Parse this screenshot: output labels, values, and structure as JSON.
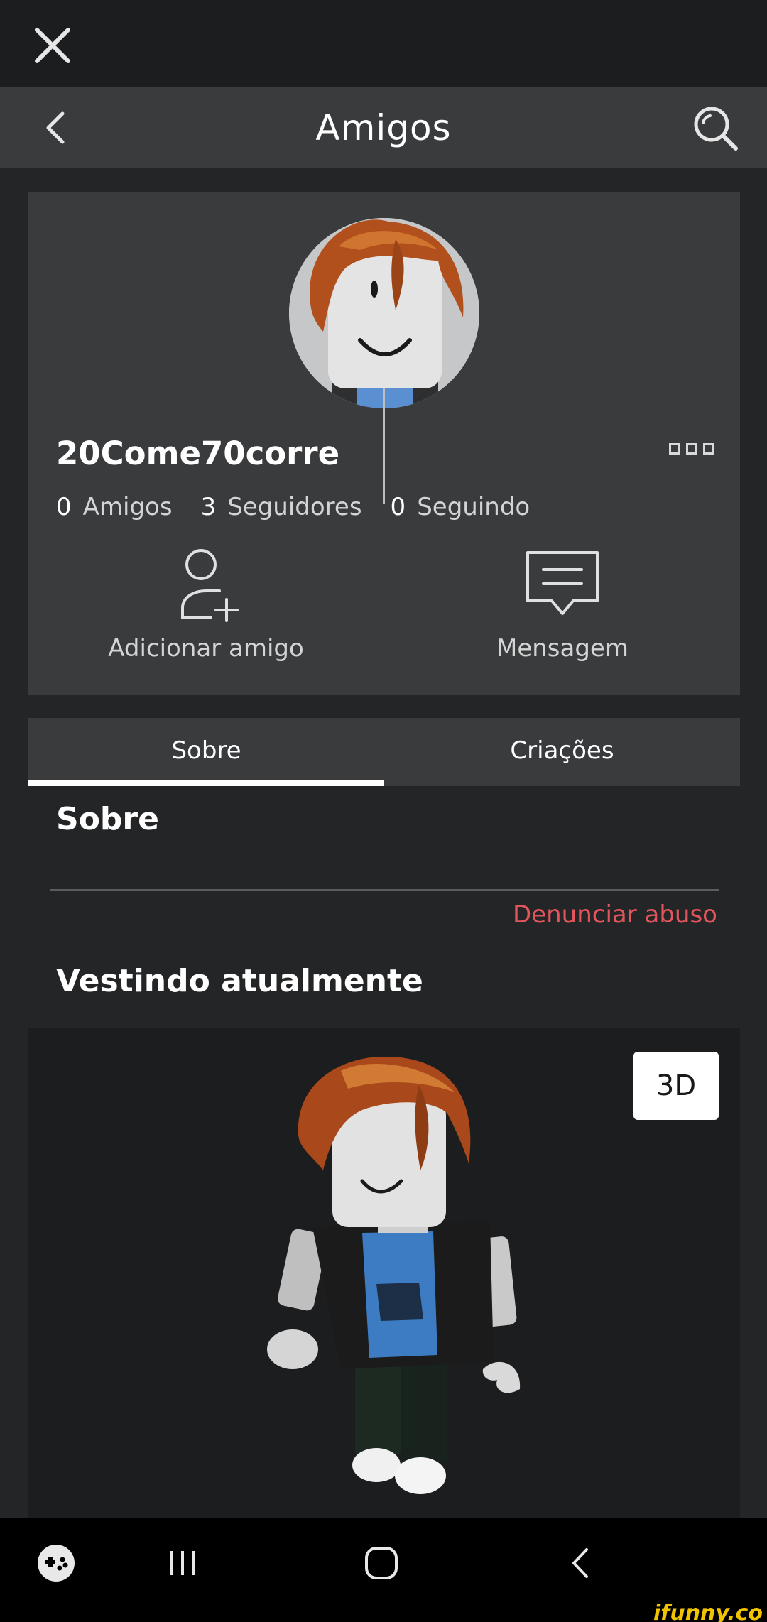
{
  "header": {
    "title": "Amigos"
  },
  "profile": {
    "username": "20Come70corre",
    "stats": [
      {
        "value": "0",
        "label": "Amigos"
      },
      {
        "value": "3",
        "label": "Seguidores"
      },
      {
        "value": "0",
        "label": "Seguindo"
      }
    ],
    "actions": {
      "add_friend": "Adicionar amigo",
      "message": "Mensagem"
    }
  },
  "tabs": {
    "about": "Sobre",
    "creations": "Criações",
    "selected": "Sobre"
  },
  "about": {
    "title": "Sobre",
    "report": "Denunciar abuso"
  },
  "wearing": {
    "title": "Vestindo atualmente",
    "view_toggle": "3D"
  },
  "watermark": "ifunny.co",
  "colors": {
    "background": "#232527",
    "card": "#393b3d",
    "report": "#e2555c",
    "stage": "#1c1d1f"
  },
  "icons": [
    "close-icon",
    "back-icon",
    "search-icon",
    "more-icon",
    "add-friend-icon",
    "message-icon",
    "game-launcher-icon",
    "recent-apps-icon",
    "home-icon",
    "system-back-icon"
  ]
}
